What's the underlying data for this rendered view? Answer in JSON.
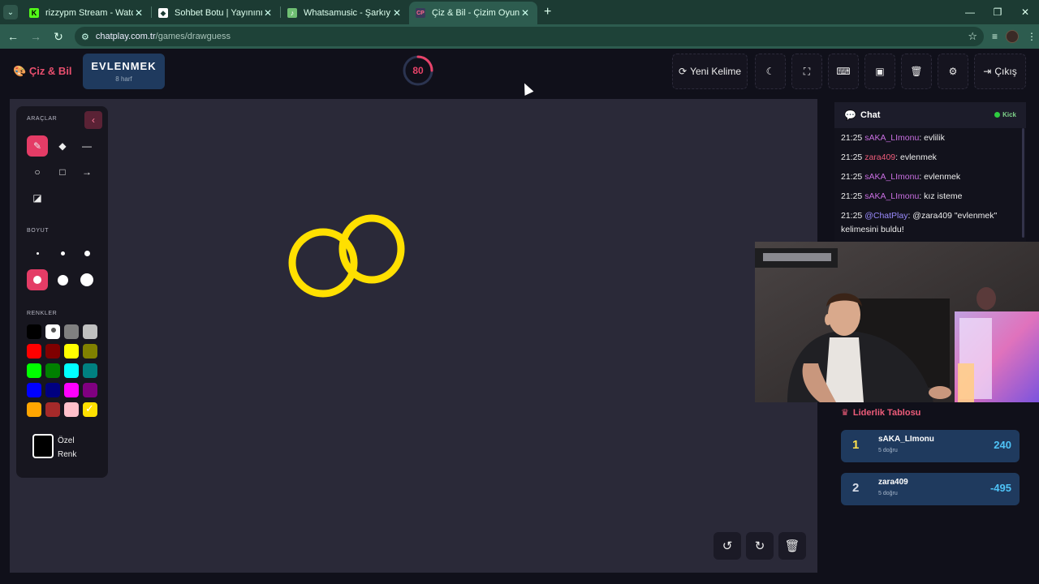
{
  "browser": {
    "tabs": [
      {
        "title": "rizzypm Stream - Watch Live on",
        "favicon": "kick-icon",
        "active": false
      },
      {
        "title": "Sohbet Botu | Yayınını güçlendir",
        "favicon": "sohbet-icon",
        "active": false
      },
      {
        "title": "Whatsamusic - Şarkıyı Tahmin E",
        "favicon": "whatsamusic-icon",
        "active": false
      },
      {
        "title": "Çiz & Bil - Çizim Oyunu",
        "favicon": "chatplay-icon",
        "active": true
      }
    ],
    "url_host": "chatplay.com.tr",
    "url_path": "/games/drawguess"
  },
  "header": {
    "brand": "Çiz & Bil",
    "word": "EVLENMEK",
    "word_length": "8 harf",
    "timer": "80",
    "timer_fraction": 0.25,
    "new_word_label": "Yeni Kelime",
    "exit_label": "Çıkış"
  },
  "tools": {
    "tools_heading": "ARAÇLAR",
    "size_heading": "BOYUT",
    "colors_heading": "RENKLER",
    "custom_color_line1": "Özel",
    "custom_color_line2": "Renk",
    "selected_tool": "pen",
    "selected_size": 4,
    "selected_color": "#ffe000",
    "palette": [
      "#000000",
      "#ffffff",
      "#808080",
      "#c0c0c0",
      "#ff0000",
      "#800000",
      "#ffff00",
      "#808000",
      "#00ff00",
      "#008000",
      "#00ffff",
      "#008080",
      "#0000ff",
      "#000080",
      "#ff00ff",
      "#800080",
      "#ffa500",
      "#a52a2a",
      "#ffc0cb",
      "#ffe000"
    ]
  },
  "chat": {
    "title": "Chat",
    "platform": "Kick",
    "messages": [
      {
        "time": "21:25",
        "user": "sAKA_LImonu",
        "text": ": evlilik"
      },
      {
        "time": "21:25",
        "user": "zara409",
        "text": ": evlenmek"
      },
      {
        "time": "21:25",
        "user": "sAKA_LImonu",
        "text": ": evlenmek"
      },
      {
        "time": "21:25",
        "user": "sAKA_LImonu",
        "text": ": kız isteme"
      },
      {
        "time": "21:25",
        "user": "@ChatPlay",
        "text": ": @zara409 \"evlenmek\" kelimesini buldu!"
      }
    ]
  },
  "leaderboard": {
    "title": "Liderlik Tablosu",
    "rows": [
      {
        "rank": "1",
        "name": "sAKA_LImonu",
        "correct": "5 doğru",
        "points": "240",
        "rank_color": "#ffe14d"
      },
      {
        "rank": "2",
        "name": "zara409",
        "correct": "5 doğru",
        "points": "-495",
        "rank_color": "#d8dde8"
      }
    ]
  },
  "colors": {
    "accent": "#e43c66",
    "brand_red": "#e84f6e",
    "points_blue": "#4fc3f7",
    "ring_yellow": "#ffe000"
  }
}
